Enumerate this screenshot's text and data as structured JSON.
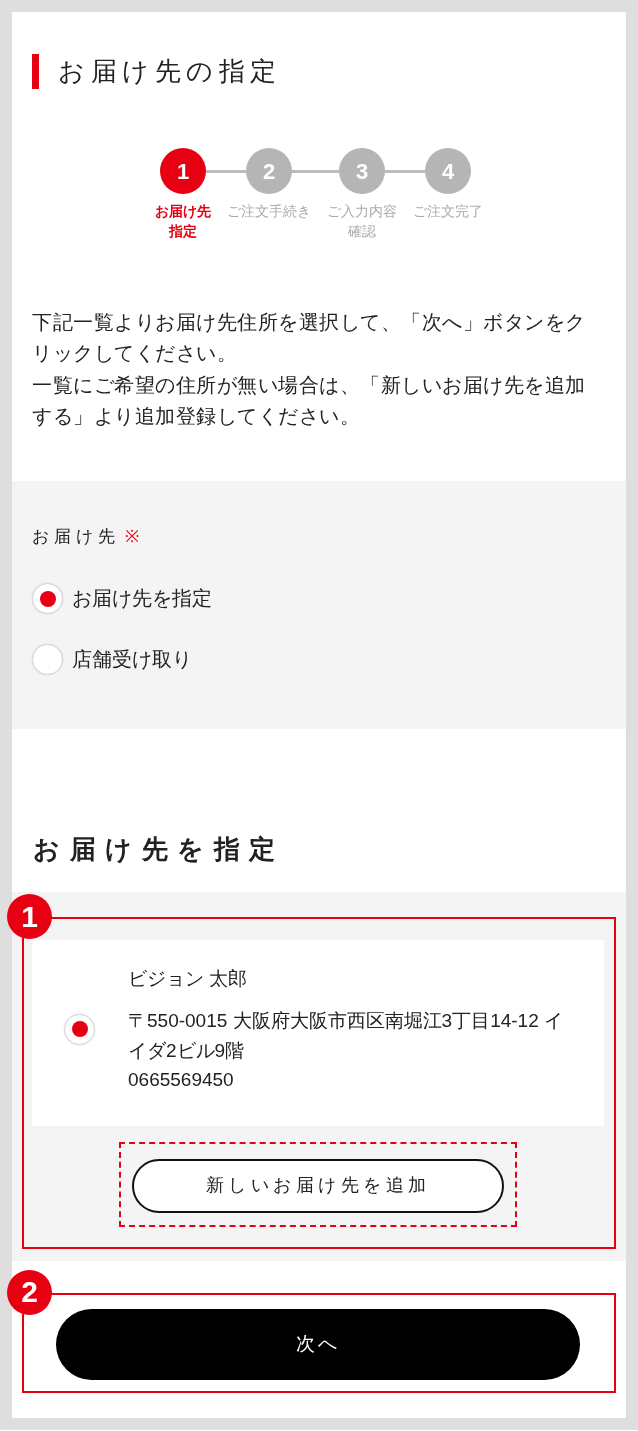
{
  "page_title": "お届け先の指定",
  "steps": [
    {
      "number": "1",
      "label_lines": [
        "お届け先",
        "指定"
      ],
      "current": true
    },
    {
      "number": "2",
      "label_lines": [
        "ご注文手続き"
      ],
      "current": false
    },
    {
      "number": "3",
      "label_lines": [
        "ご入力内容",
        "確認"
      ],
      "current": false
    },
    {
      "number": "4",
      "label_lines": [
        "ご注文完了"
      ],
      "current": false
    }
  ],
  "instructions": [
    "下記一覧よりお届け先住所を選択して、「次へ」ボタンをクリックしてください。",
    "一覧にご希望の住所が無い場合は、「新しいお届け先を追加する」より追加登録してください。"
  ],
  "delivery_method": {
    "label": "お届け先",
    "required_mark": "※",
    "options": [
      {
        "label": "お届け先を指定",
        "selected": true
      },
      {
        "label": "店舗受け取り",
        "selected": false
      }
    ]
  },
  "address_section": {
    "title": "お届け先を指定",
    "annotation": "1",
    "addresses": [
      {
        "name": "ビジョン 太郎",
        "address": "〒550-0015 大阪府大阪市西区南堀江3丁目14-12 イイダ2ビル9階",
        "phone": "0665569450",
        "selected": true
      }
    ],
    "add_button": {
      "label": "新しいお届け先を追加",
      "highlighted": true
    }
  },
  "next_step": {
    "annotation": "2",
    "button": "次へ"
  }
}
